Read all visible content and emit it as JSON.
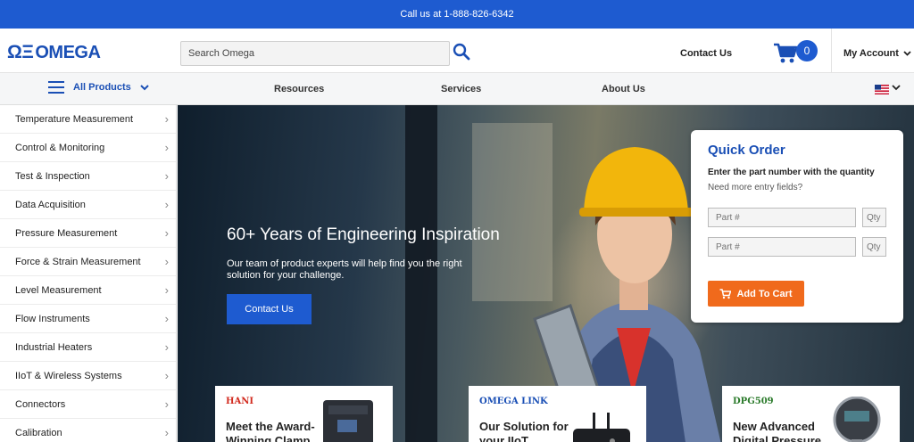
{
  "topbar": {
    "call_text": "Call us at 1-888-826-6342"
  },
  "header": {
    "logo_text": "OMEGA",
    "search_placeholder": "Search Omega",
    "contact_label": "Contact Us",
    "cart_count": "0",
    "account_label": "My Account"
  },
  "nav": {
    "all_products": "All Products",
    "links": [
      "Resources",
      "Services",
      "About Us"
    ]
  },
  "sidebar": {
    "items": [
      "Temperature Measurement",
      "Control & Monitoring",
      "Test & Inspection",
      "Data Acquisition",
      "Pressure Measurement",
      "Force & Strain Measurement",
      "Level Measurement",
      "Flow Instruments",
      "Industrial Heaters",
      "IIoT & Wireless Systems",
      "Connectors",
      "Calibration"
    ]
  },
  "hero": {
    "title": "60+ Years of Engineering Inspiration",
    "subtitle": "Our team of product experts will help find you the right solution for your challenge.",
    "button": "Contact Us"
  },
  "quick_order": {
    "title": "Quick Order",
    "label": "Enter the part number with the quantity",
    "more_fields": "Need more entry fields?",
    "part_placeholder": "Part #",
    "qty_placeholder": "Qty",
    "button": "Add To Cart"
  },
  "cards": [
    {
      "tag": "HANI",
      "tag_color": "#d22b1f",
      "title": "Meet the Award-Winning Clamp"
    },
    {
      "tag": "OMEGA LINK",
      "tag_color": "#1a4fb5",
      "title": "Our Solution for your IIoT"
    },
    {
      "tag": "DPG509",
      "tag_color": "#2a7a2a",
      "title": "New Advanced Digital Pressure"
    }
  ],
  "colors": {
    "brand_blue": "#1e5bd0",
    "accent_orange": "#f06a1c"
  }
}
